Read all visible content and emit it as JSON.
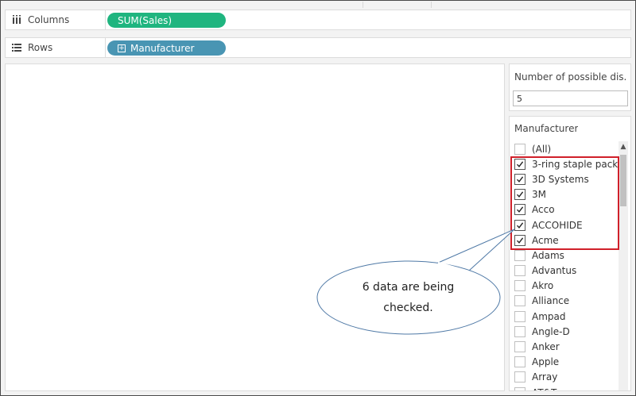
{
  "shelves": {
    "columns": {
      "label": "Columns",
      "icon": "columns-icon",
      "pill": "SUM(Sales)",
      "pill_color": "#1fb57f"
    },
    "rows": {
      "label": "Rows",
      "icon": "rows-icon",
      "pill": "Manufacturer",
      "pill_color": "#4995b3"
    }
  },
  "parameter": {
    "title": "Number of possible dis...",
    "value": "5"
  },
  "filter": {
    "title": "Manufacturer",
    "items": [
      {
        "label": "(All)",
        "checked": false
      },
      {
        "label": "3-ring staple pack",
        "checked": true
      },
      {
        "label": "3D Systems",
        "checked": true
      },
      {
        "label": "3M",
        "checked": true
      },
      {
        "label": "Acco",
        "checked": true
      },
      {
        "label": "ACCOHIDE",
        "checked": true
      },
      {
        "label": "Acme",
        "checked": true
      },
      {
        "label": "Adams",
        "checked": false
      },
      {
        "label": "Advantus",
        "checked": false
      },
      {
        "label": "Akro",
        "checked": false
      },
      {
        "label": "Alliance",
        "checked": false
      },
      {
        "label": "Ampad",
        "checked": false
      },
      {
        "label": "Angle-D",
        "checked": false
      },
      {
        "label": "Anker",
        "checked": false
      },
      {
        "label": "Apple",
        "checked": false
      },
      {
        "label": "Array",
        "checked": false
      },
      {
        "label": "AT&T",
        "checked": false
      }
    ]
  },
  "annotation": {
    "line1": "6 data are being",
    "line2": "checked.",
    "highlight_color": "#d0202a"
  }
}
